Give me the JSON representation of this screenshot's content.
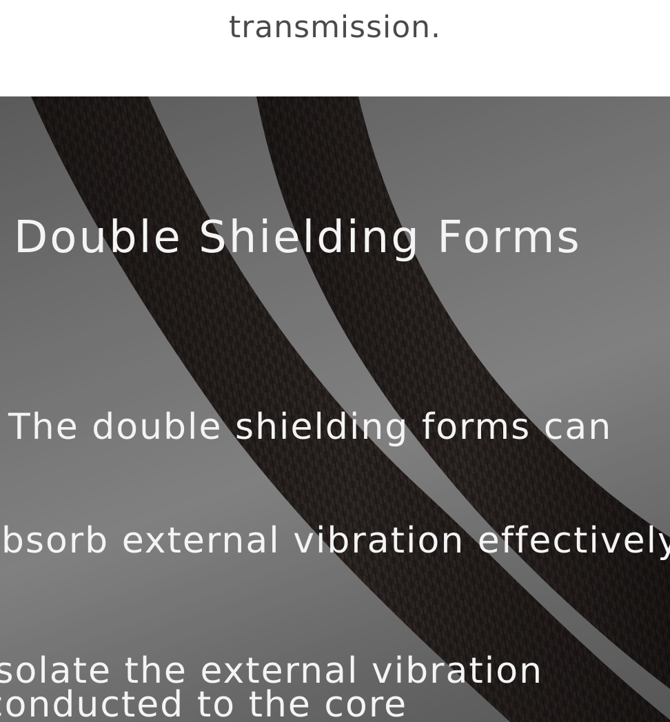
{
  "top": {
    "caption": "transmission."
  },
  "photo": {
    "icon": "braided-cable-photo",
    "headline": "Double Shielding Forms",
    "lines": [
      "The double shielding forms can",
      "absorb external vibration effectively",
      "isolate the external vibration conducted to the core"
    ]
  },
  "colors": {
    "caption": "#4a4a4a",
    "overlay_text": "#f4f4f4",
    "cable": "#2b2624"
  }
}
